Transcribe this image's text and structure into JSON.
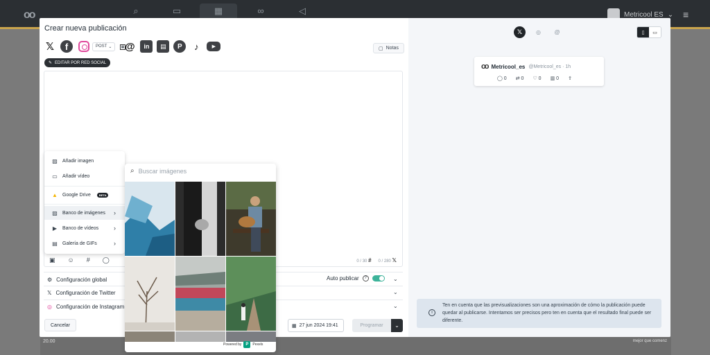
{
  "app": {
    "account_name": "Metricool ES",
    "footer_left": "20.00",
    "footer_right": "mejor que comenz"
  },
  "modal": {
    "title": "Crear nueva publicación",
    "post_type": "POST",
    "notes_label": "Notas",
    "edit_per_network_label": "EDITAR POR RED SOCIAL",
    "counters": {
      "hashtags": "0 / 30",
      "chars": "0 / 280"
    },
    "config": {
      "global": "Configuración global",
      "twitter": "Configuración de Twitter",
      "instagram": "Configuración de Instagram",
      "auto_publish": "Auto publicar"
    },
    "cancel_label": "Cancelar",
    "date_value": "27 jun 2024 19:41",
    "schedule_label": "Programar"
  },
  "media_menu": {
    "items": [
      {
        "label": "Añadir imagen"
      },
      {
        "label": "Añadir vídeo"
      },
      {
        "label": "Google Drive",
        "badge": "BETA"
      },
      {
        "label": "Banco de imágenes"
      },
      {
        "label": "Banco de vídeos"
      },
      {
        "label": "Galería de GIFs"
      }
    ]
  },
  "image_bank": {
    "search_placeholder": "Buscar imágenes",
    "powered_by": "Powered by",
    "provider": "Pexels"
  },
  "preview": {
    "tweet": {
      "name": "Metricool_es",
      "handle": "@Metricool_es · 1h",
      "replies": "0",
      "retweets": "0",
      "likes": "0",
      "views": "0"
    },
    "notice": "Ten en cuenta que las previsualizaciones son una aproximación de cómo la publicación puede quedar al publicarse. Intentamos ser precisos pero ten en cuenta que el resultado final puede ser diferente."
  },
  "colors": {
    "accent_toggle": "#3db39a",
    "dark": "#202428",
    "notice_bg": "#dde5ee"
  }
}
